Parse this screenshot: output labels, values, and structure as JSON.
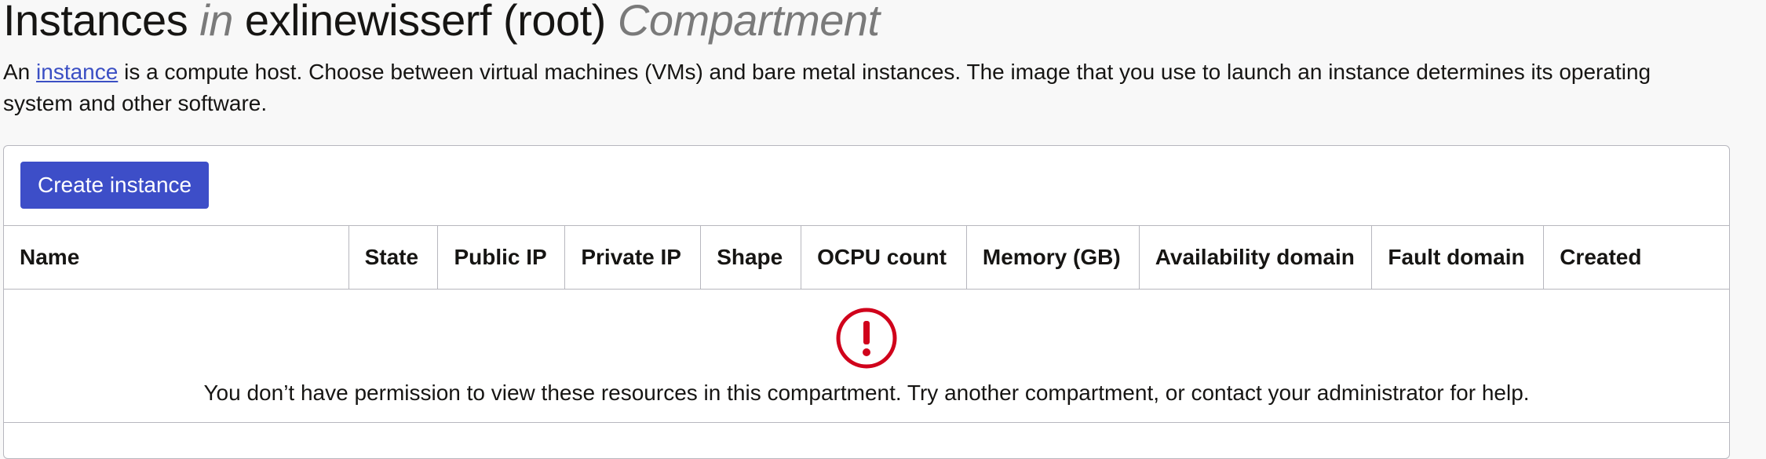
{
  "header": {
    "title_part1": "Instances",
    "title_in": "in",
    "title_compartment_name": "exlinewisserf (root)",
    "title_compartment_word": "Compartment"
  },
  "description": {
    "prefix": "An ",
    "link_text": "instance",
    "suffix": " is a compute host. Choose between virtual machines (VMs) and bare metal instances. The image that you use to launch an instance determines its operating system and other software."
  },
  "toolbar": {
    "create_label": "Create instance"
  },
  "table": {
    "columns": [
      "Name",
      "State",
      "Public IP",
      "Private IP",
      "Shape",
      "OCPU count",
      "Memory (GB)",
      "Availability domain",
      "Fault domain",
      "Created"
    ],
    "empty_message": "You don’t have permission to view these resources in this compartment. Try another compartment, or contact your administrator for help.",
    "empty_icon": "alert-circle-icon"
  },
  "colors": {
    "primary_button": "#3d4ec8",
    "link": "#3b4fc4",
    "error": "#d0021b",
    "muted_title": "#7a7a7a",
    "border": "#b7b7be"
  }
}
